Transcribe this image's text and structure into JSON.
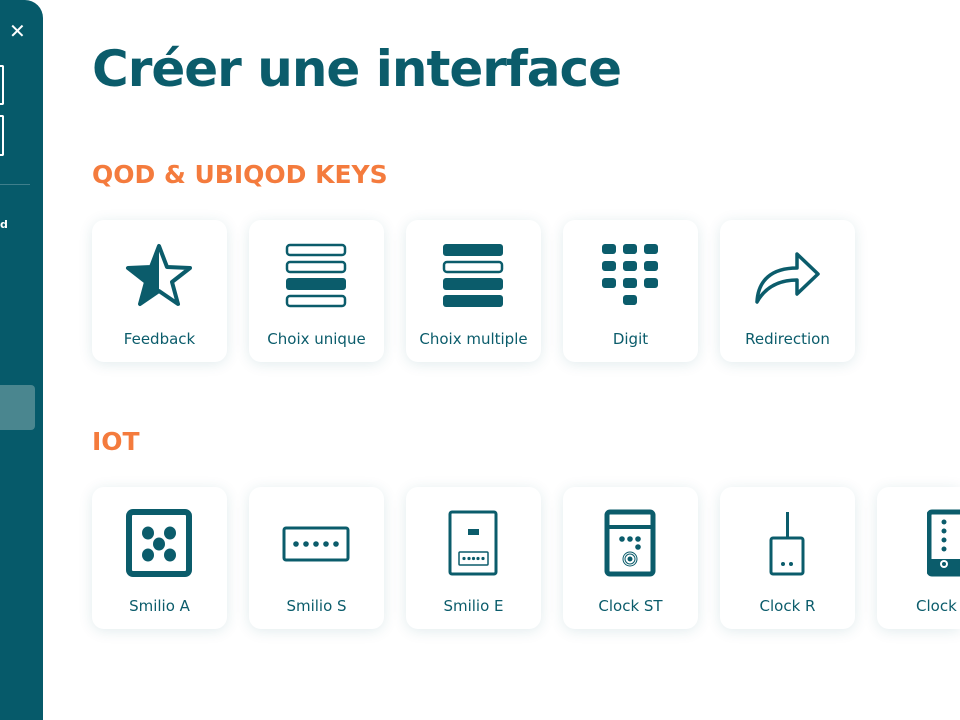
{
  "sidebar": {
    "close_icon": "close-icon",
    "partial_text": "d"
  },
  "title": "Créer une interface",
  "sections": [
    {
      "title": "QOD & UBIQOD KEYS",
      "items": [
        {
          "label": "Feedback",
          "icon": "star-half-icon"
        },
        {
          "label": "Choix unique",
          "icon": "single-choice-icon"
        },
        {
          "label": "Choix multiple",
          "icon": "multiple-choice-icon"
        },
        {
          "label": "Digit",
          "icon": "keypad-icon"
        },
        {
          "label": "Redirection",
          "icon": "redirect-arrow-icon"
        }
      ]
    },
    {
      "title": "IOT",
      "items": [
        {
          "label": "Smilio A",
          "icon": "smilio-a-icon"
        },
        {
          "label": "Smilio S",
          "icon": "smilio-s-icon"
        },
        {
          "label": "Smilio E",
          "icon": "smilio-e-icon"
        },
        {
          "label": "Clock ST",
          "icon": "clock-st-icon"
        },
        {
          "label": "Clock R",
          "icon": "clock-r-icon"
        },
        {
          "label": "Clock",
          "icon": "clock-icon"
        }
      ]
    }
  ],
  "colors": {
    "primary": "#0b5c6b",
    "accent": "#f47b3d",
    "sidebar": "#065a6a"
  }
}
